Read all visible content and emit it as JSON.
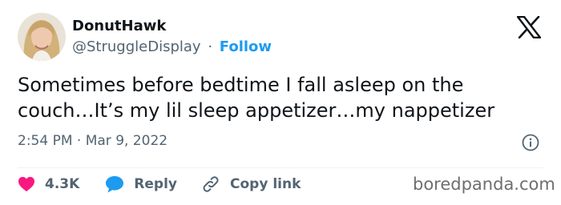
{
  "author": {
    "display_name": "DonutHawk",
    "handle": "@StruggleDisplay",
    "separator": "·",
    "follow_label": "Follow",
    "avatar": "profile-photo"
  },
  "platform_icon": "x-logo-icon",
  "tweet": {
    "text_line_1": "Sometimes before bedtime I fall asleep on the",
    "text_line_2": "couch…It’s my lil sleep appetizer…my nappetizer",
    "timestamp": "2:54 PM · Mar 9, 2022"
  },
  "actions": {
    "like_count": "4.3K",
    "reply_label": "Reply",
    "copy_link_label": "Copy link"
  },
  "icons": {
    "like": "heart-icon",
    "reply": "speech-bubble-icon",
    "copy_link": "link-icon",
    "info": "info-icon"
  },
  "colors": {
    "text": "#0f1419",
    "secondary": "#536471",
    "accent": "#1d9bf0",
    "like": "#f91880"
  },
  "watermark": "boredpanda.com"
}
